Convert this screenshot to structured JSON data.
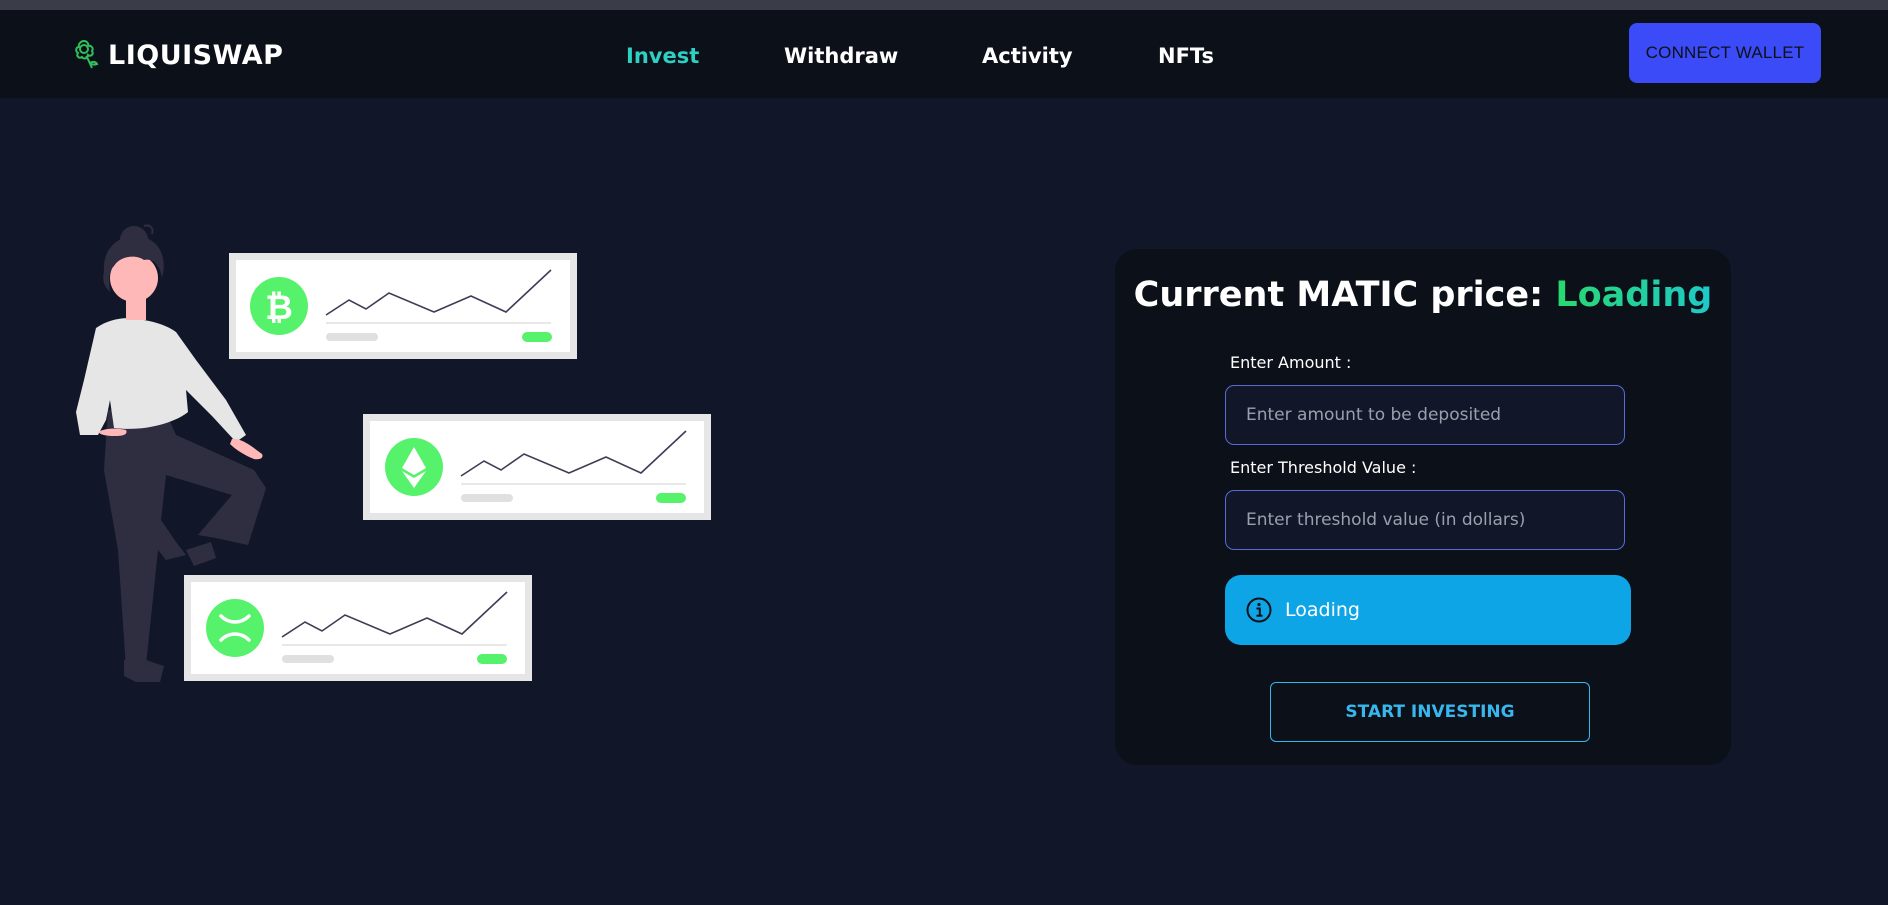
{
  "app": {
    "brand": "LIQUISWAP",
    "brand_icon": "flower-icon",
    "accent_color": "#2fd0c3"
  },
  "nav": {
    "links": [
      {
        "label": "Invest",
        "active": true
      },
      {
        "label": "Withdraw",
        "active": false
      },
      {
        "label": "Activity",
        "active": false
      },
      {
        "label": "NFTs",
        "active": false
      }
    ],
    "connect_label": "CONNECT WALLET"
  },
  "illustration": {
    "coins": [
      "bitcoin-icon",
      "ethereum-icon",
      "xrp-icon"
    ],
    "coin_color": "#57f26b"
  },
  "card": {
    "title_prefix": "Current MATIC price:",
    "title_value": "Loading",
    "amount_label": "Enter Amount :",
    "amount_placeholder": "Enter amount to be deposited",
    "threshold_label": "Enter Threshold Value :",
    "threshold_placeholder": "Enter threshold value (in dollars)",
    "alert_icon": "info-icon",
    "alert_text": "Loading",
    "alert_color": "#0ea5e6",
    "start_label": "START INVESTING"
  }
}
